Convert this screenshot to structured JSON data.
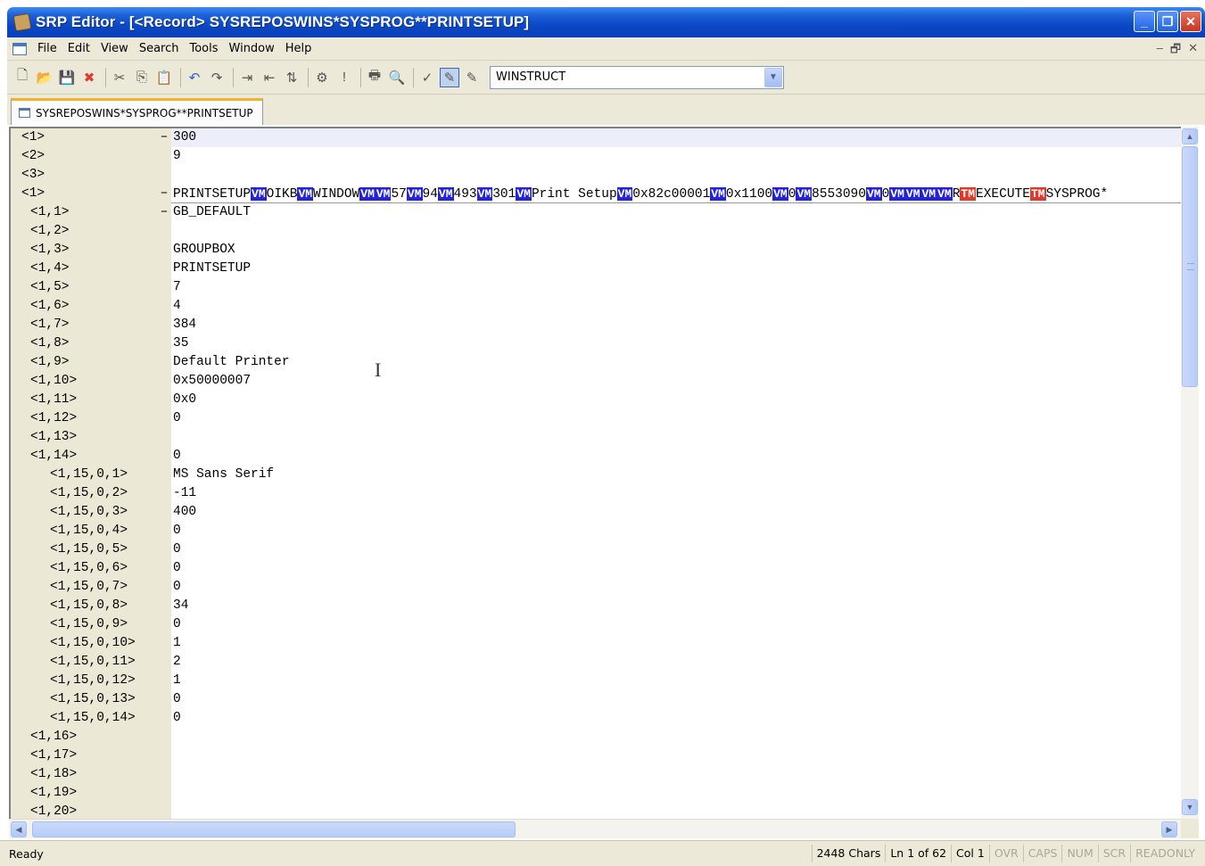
{
  "window": {
    "title": "SRP Editor - [<Record> SYSREPOSWINS*SYSPROG**PRINTSETUP]",
    "buttons": {
      "minimize": "_",
      "restore": "❐",
      "close": "✕"
    }
  },
  "menu": {
    "items": [
      "File",
      "Edit",
      "View",
      "Search",
      "Tools",
      "Window",
      "Help"
    ],
    "mdi_buttons": {
      "minimize": "–",
      "restore": "🗗",
      "close": "✕"
    }
  },
  "toolbar": {
    "buttons": [
      {
        "name": "new-icon",
        "glyph": "🗋"
      },
      {
        "name": "open-folder-icon",
        "glyph": "📂"
      },
      {
        "name": "save-icon",
        "glyph": "💾"
      },
      {
        "name": "delete-icon",
        "glyph": "✖",
        "color": "#e03a2a"
      },
      {
        "sep": true
      },
      {
        "name": "cut-icon",
        "glyph": "✂"
      },
      {
        "name": "copy-icon",
        "glyph": "⎘"
      },
      {
        "name": "paste-icon",
        "glyph": "📋"
      },
      {
        "sep": true
      },
      {
        "name": "undo-icon",
        "glyph": "↶",
        "color": "#2e62c9"
      },
      {
        "name": "redo-icon",
        "glyph": "↷"
      },
      {
        "sep": true
      },
      {
        "name": "indent-icon",
        "glyph": "⇥"
      },
      {
        "name": "outdent-icon",
        "glyph": "⇤"
      },
      {
        "name": "sort-icon",
        "glyph": "⇅"
      },
      {
        "sep": true
      },
      {
        "name": "compile-icon",
        "glyph": "⚙"
      },
      {
        "name": "exclamation-icon",
        "glyph": "!"
      },
      {
        "sep": true
      },
      {
        "name": "print-icon",
        "glyph": "🖶"
      },
      {
        "name": "print-preview-icon",
        "glyph": "🔍"
      },
      {
        "sep": true
      },
      {
        "name": "check-icon",
        "glyph": "✓"
      },
      {
        "name": "edit-mode-icon",
        "glyph": "✎",
        "active": true
      },
      {
        "name": "edit-alt-icon",
        "glyph": "✎"
      }
    ],
    "combo": {
      "value": "WINSTRUCT",
      "arrow": "▼"
    }
  },
  "tab": {
    "label": "SYSREPOSWINS*SYSPROG**PRINTSETUP"
  },
  "editor": {
    "rows": [
      {
        "label": "<1>",
        "indent": 0,
        "fold": "–",
        "content": "300",
        "current": true
      },
      {
        "label": "<2>",
        "indent": 0,
        "content": "9"
      },
      {
        "label": "<3>",
        "indent": 0,
        "content": ""
      },
      {
        "label": "<1>",
        "indent": 0,
        "fold": "–",
        "underline": true,
        "segments": [
          {
            "t": "PRINTSETUP"
          },
          {
            "t": "VM",
            "m": "vm"
          },
          {
            "t": "OIKB"
          },
          {
            "t": "VM",
            "m": "vm"
          },
          {
            "t": "WINDOW"
          },
          {
            "t": "VM",
            "m": "vm"
          },
          {
            "t": "VM",
            "m": "vm"
          },
          {
            "t": "57"
          },
          {
            "t": "VM",
            "m": "vm"
          },
          {
            "t": "94"
          },
          {
            "t": "VM",
            "m": "vm"
          },
          {
            "t": "493"
          },
          {
            "t": "VM",
            "m": "vm"
          },
          {
            "t": "301"
          },
          {
            "t": "VM",
            "m": "vm"
          },
          {
            "t": "Print Setup"
          },
          {
            "t": "VM",
            "m": "vm"
          },
          {
            "t": "0x82c00001"
          },
          {
            "t": "VM",
            "m": "vm"
          },
          {
            "t": "0x1100"
          },
          {
            "t": "VM",
            "m": "vm"
          },
          {
            "t": "0"
          },
          {
            "t": "VM",
            "m": "vm"
          },
          {
            "t": "8553090"
          },
          {
            "t": "VM",
            "m": "vm"
          },
          {
            "t": "0"
          },
          {
            "t": "VM",
            "m": "vm"
          },
          {
            "t": "VM",
            "m": "vm"
          },
          {
            "t": "VM",
            "m": "vm"
          },
          {
            "t": "VM",
            "m": "vm"
          },
          {
            "t": "R"
          },
          {
            "t": "TM",
            "m": "tm"
          },
          {
            "t": "EXECUTE"
          },
          {
            "t": "TM",
            "m": "tm"
          },
          {
            "t": "SYSPROG*"
          }
        ]
      },
      {
        "label": "<1,1>",
        "indent": 1,
        "fold": "–",
        "content": "GB_DEFAULT"
      },
      {
        "label": "<1,2>",
        "indent": 1,
        "content": ""
      },
      {
        "label": "<1,3>",
        "indent": 1,
        "content": "GROUPBOX"
      },
      {
        "label": "<1,4>",
        "indent": 1,
        "content": "PRINTSETUP"
      },
      {
        "label": "<1,5>",
        "indent": 1,
        "content": "7"
      },
      {
        "label": "<1,6>",
        "indent": 1,
        "content": "4"
      },
      {
        "label": "<1,7>",
        "indent": 1,
        "content": "384"
      },
      {
        "label": "<1,8>",
        "indent": 1,
        "content": "35"
      },
      {
        "label": "<1,9>",
        "indent": 1,
        "content": "Default Printer"
      },
      {
        "label": "<1,10>",
        "indent": 1,
        "content": "0x50000007"
      },
      {
        "label": "<1,11>",
        "indent": 1,
        "content": "0x0"
      },
      {
        "label": "<1,12>",
        "indent": 1,
        "content": "0"
      },
      {
        "label": "<1,13>",
        "indent": 1,
        "content": ""
      },
      {
        "label": "<1,14>",
        "indent": 1,
        "content": "0"
      },
      {
        "label": "<1,15,0,1>",
        "indent": 2,
        "content": "MS Sans Serif"
      },
      {
        "label": "<1,15,0,2>",
        "indent": 2,
        "content": "-11"
      },
      {
        "label": "<1,15,0,3>",
        "indent": 2,
        "content": "400"
      },
      {
        "label": "<1,15,0,4>",
        "indent": 2,
        "content": "0"
      },
      {
        "label": "<1,15,0,5>",
        "indent": 2,
        "content": "0"
      },
      {
        "label": "<1,15,0,6>",
        "indent": 2,
        "content": "0"
      },
      {
        "label": "<1,15,0,7>",
        "indent": 2,
        "content": "0"
      },
      {
        "label": "<1,15,0,8>",
        "indent": 2,
        "content": "34"
      },
      {
        "label": "<1,15,0,9>",
        "indent": 2,
        "content": "0"
      },
      {
        "label": "<1,15,0,10>",
        "indent": 2,
        "content": "1"
      },
      {
        "label": "<1,15,0,11>",
        "indent": 2,
        "content": "2"
      },
      {
        "label": "<1,15,0,12>",
        "indent": 2,
        "content": "1"
      },
      {
        "label": "<1,15,0,13>",
        "indent": 2,
        "content": "0"
      },
      {
        "label": "<1,15,0,14>",
        "indent": 2,
        "content": "0"
      },
      {
        "label": "<1,16>",
        "indent": 1,
        "content": ""
      },
      {
        "label": "<1,17>",
        "indent": 1,
        "content": ""
      },
      {
        "label": "<1,18>",
        "indent": 1,
        "content": ""
      },
      {
        "label": "<1,19>",
        "indent": 1,
        "content": ""
      },
      {
        "label": "<1,20>",
        "indent": 1,
        "content": ""
      }
    ]
  },
  "scrollbars": {
    "up": "▲",
    "down": "▼",
    "left": "◀",
    "right": "▶"
  },
  "status": {
    "ready": "Ready",
    "chars": "2448 Chars",
    "line": "Ln 1 of 62",
    "col": "Col 1",
    "ovr": "OVR",
    "caps": "CAPS",
    "num": "NUM",
    "scr": "SCR",
    "readonly": "READONLY"
  }
}
